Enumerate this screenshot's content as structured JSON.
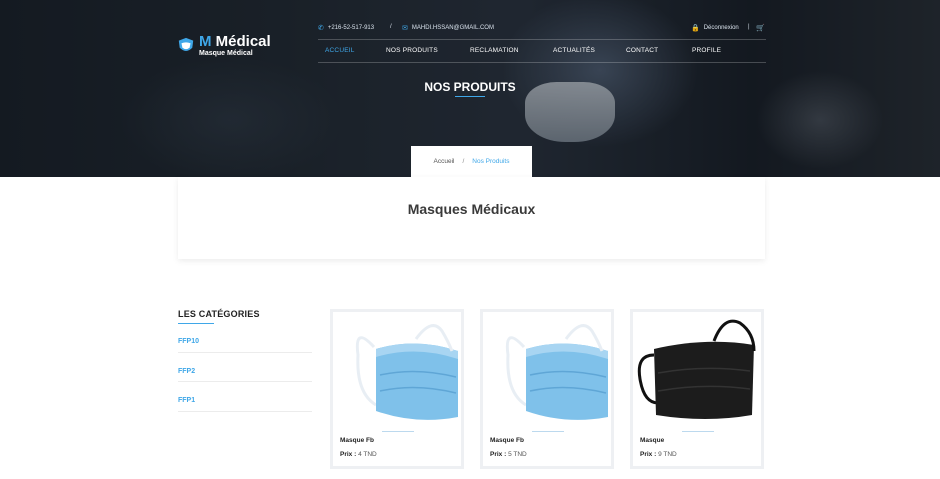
{
  "header": {
    "logo_title_m": "M",
    "logo_title_rest": " Médical",
    "logo_subtitle": "Masque Médical",
    "phone": "+216-52-517-913",
    "separator": "/",
    "email": "MAHDI.HSSAN@GMAIL.COM",
    "logout": "Déconnexion",
    "divider": "|",
    "nav": [
      "ACCUEIL",
      "NOS PRODUITS",
      "RECLAMATION",
      "ACTUALITÉS",
      "CONTACT",
      "PROFILE"
    ]
  },
  "hero": {
    "title": "NOS PRODUITS",
    "breadcrumb_home": "Accueil",
    "breadcrumb_sep": "/",
    "breadcrumb_current": "Nos Produits"
  },
  "page": {
    "title": "Masques Médicaux"
  },
  "categories": {
    "title": "LES CATÉGORIES",
    "items": [
      "FFP10",
      "FFP2",
      "FFP1"
    ]
  },
  "products": [
    {
      "name": "Masque Fb",
      "price_label": "Prix :",
      "price": "4 TND",
      "color": "#7fc1ea"
    },
    {
      "name": "Masque Fb",
      "price_label": "Prix :",
      "price": "5 TND",
      "color": "#7fc1ea"
    },
    {
      "name": "Masque",
      "price_label": "Prix :",
      "price": "9 TND",
      "color": "#1c1c1c"
    }
  ],
  "colors": {
    "accent": "#3fa7e8"
  }
}
